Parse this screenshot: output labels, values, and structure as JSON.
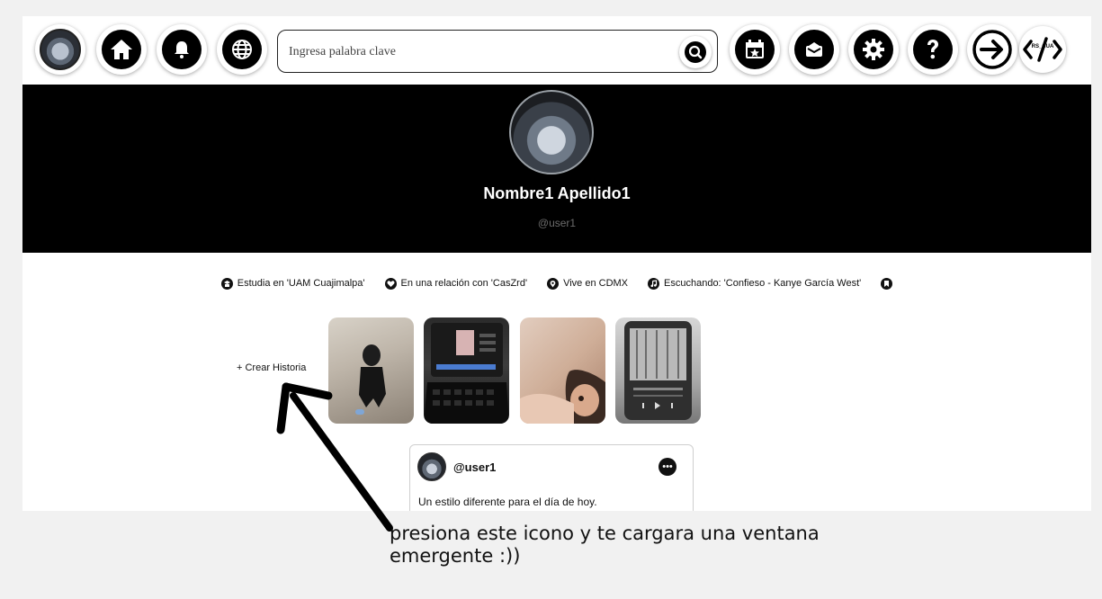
{
  "nav": {
    "profile_icon": "avatar",
    "home_icon": "home-icon",
    "notifications_icon": "bell-icon",
    "explore_icon": "globe-icon",
    "events_icon": "calendar-star-icon",
    "messages_icon": "mail-icon",
    "settings_icon": "gear-icon",
    "help_icon": "question-icon",
    "logout_icon": "arrow-right-icon",
    "brand_badge": "RS_CUA",
    "search": {
      "placeholder": "Ingresa palabra clave"
    }
  },
  "profile": {
    "name": "Nombre1 Apellido1",
    "handle": "@user1"
  },
  "info": [
    {
      "icon": "school-icon",
      "text": "Estudia en 'UAM Cuajimalpa'"
    },
    {
      "icon": "heart-icon",
      "text": "En una relación con 'CasZrd'"
    },
    {
      "icon": "location-icon",
      "text": "Vive en CDMX"
    },
    {
      "icon": "music-icon",
      "text": "Escuchando: 'Confieso - Kanye García West'"
    },
    {
      "icon": "bookmark-icon",
      "text": ""
    }
  ],
  "stories": {
    "create_label": "+ Crear Historia",
    "items": [
      "story-1",
      "story-2",
      "story-3",
      "story-4"
    ]
  },
  "post": {
    "user": "@user1",
    "text": "Un estilo diferente para el día de hoy."
  },
  "annotation": {
    "text": "presiona este icono y te cargara una ventana emergente :))"
  },
  "colors": {
    "background": "#f1f1f1",
    "header": "#000000",
    "accent": "#000000"
  }
}
